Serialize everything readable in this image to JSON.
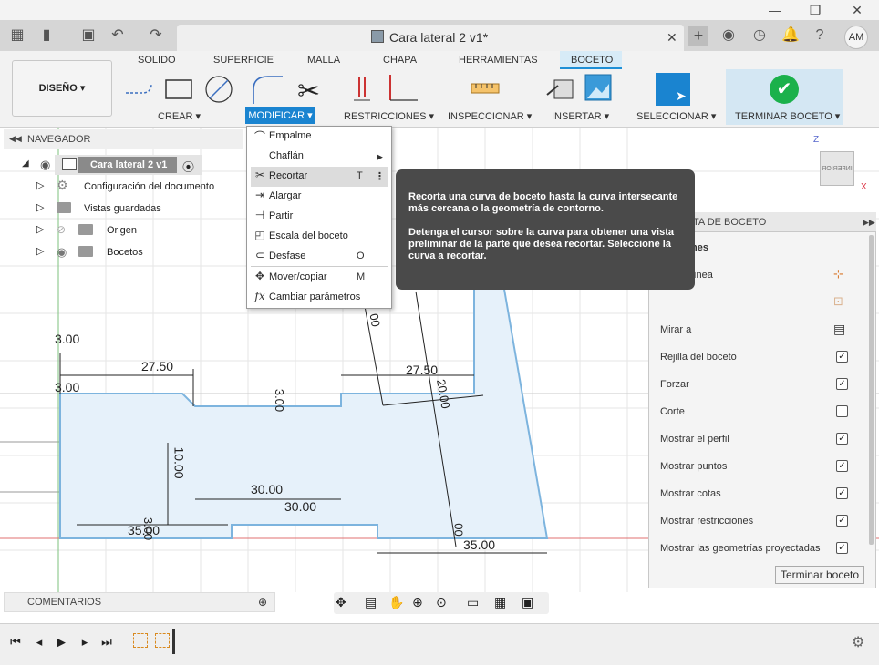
{
  "window": {
    "minimize": "—",
    "maximize": "❐",
    "close": "✕"
  },
  "appbar": {
    "doc_title": "Cara lateral 2 v1*",
    "tab_close": "✕",
    "new_tab": "+",
    "avatar": "AM",
    "icons": [
      "grid-icon",
      "file-icon",
      "save-icon",
      "undo-icon",
      "redo-icon",
      "extensions-icon",
      "jobs-icon",
      "notifications-icon",
      "help-icon"
    ]
  },
  "toolbar": {
    "tabs": [
      "SOLIDO",
      "SUPERFICIE",
      "MALLA",
      "CHAPA",
      "HERRAMIENTAS",
      "BOCETO"
    ],
    "active_tab": "BOCETO",
    "workspace": "DISEÑO ▾",
    "groups": {
      "crear": "CREAR ▾",
      "modificar": "MODIFICAR ▾",
      "restricciones": "RESTRICCIONES ▾",
      "inspeccionar": "INSPECCIONAR ▾",
      "insertar": "INSERTAR ▾",
      "seleccionar": "SELECCIONAR ▾",
      "terminar": "TERMINAR BOCETO ▾"
    }
  },
  "navigator": {
    "title": "NAVEGADOR",
    "root": "Cara lateral 2 v1",
    "items": [
      "Configuración del documento",
      "Vistas guardadas",
      "Origen",
      "Bocetos"
    ]
  },
  "modify_menu": {
    "items": [
      {
        "icon": "fillet-icon",
        "glyph": "⌒",
        "label": "Empalme",
        "shortcut": ""
      },
      {
        "icon": "chamfer-icon",
        "glyph": "",
        "label": "Chaflán",
        "shortcut": "▶"
      },
      {
        "icon": "trim-icon",
        "glyph": "✂",
        "label": "Recortar",
        "shortcut": "T"
      },
      {
        "icon": "extend-icon",
        "glyph": "⇥",
        "label": "Alargar",
        "shortcut": ""
      },
      {
        "icon": "break-icon",
        "glyph": "⊣",
        "label": "Partir",
        "shortcut": ""
      },
      {
        "icon": "sketch-scale-icon",
        "glyph": "◰",
        "label": "Escala del boceto",
        "shortcut": ""
      },
      {
        "icon": "offset-icon",
        "glyph": "⊂",
        "label": "Desfase",
        "shortcut": "O"
      },
      {
        "icon": "move-icon",
        "glyph": "✥",
        "label": "Mover/copiar",
        "shortcut": "M"
      },
      {
        "icon": "change-parameters-icon",
        "glyph": "fx",
        "label": "Cambiar parámetros",
        "shortcut": ""
      }
    ]
  },
  "tooltip": {
    "line1": "Recorta una curva de boceto hasta la curva intersecante más cercana o la geometría de contorno.",
    "line2": "Detenga el cursor sobre la curva para obtener una vista preliminar de la parte que desea recortar. Seleccione la curva a recortar."
  },
  "palette": {
    "title": "TA DE BOCETO",
    "section": "nes",
    "line_label": "línea",
    "options": [
      {
        "label": "Mirar a",
        "checked": null
      },
      {
        "label": "Rejilla del boceto",
        "checked": true
      },
      {
        "label": "Forzar",
        "checked": true
      },
      {
        "label": "Corte",
        "checked": false
      },
      {
        "label": "Mostrar el perfil",
        "checked": true
      },
      {
        "label": "Mostrar puntos",
        "checked": true
      },
      {
        "label": "Mostrar cotas",
        "checked": true
      },
      {
        "label": "Mostrar restricciones",
        "checked": true
      },
      {
        "label": "Mostrar las geometrías proyectadas",
        "checked": true
      }
    ],
    "finish": "Terminar boceto"
  },
  "viewcube": {
    "face": "INFERIOR",
    "z": "Z",
    "x": "X"
  },
  "dimensions": [
    "3.00",
    "27.50",
    "3.00",
    "27.50",
    "3.00",
    "10.00",
    "30.00",
    "30.00",
    "35.00",
    "3.00",
    "35.00",
    "00",
    "20.00",
    "00"
  ],
  "comments": {
    "title": "COMENTARIOS"
  }
}
